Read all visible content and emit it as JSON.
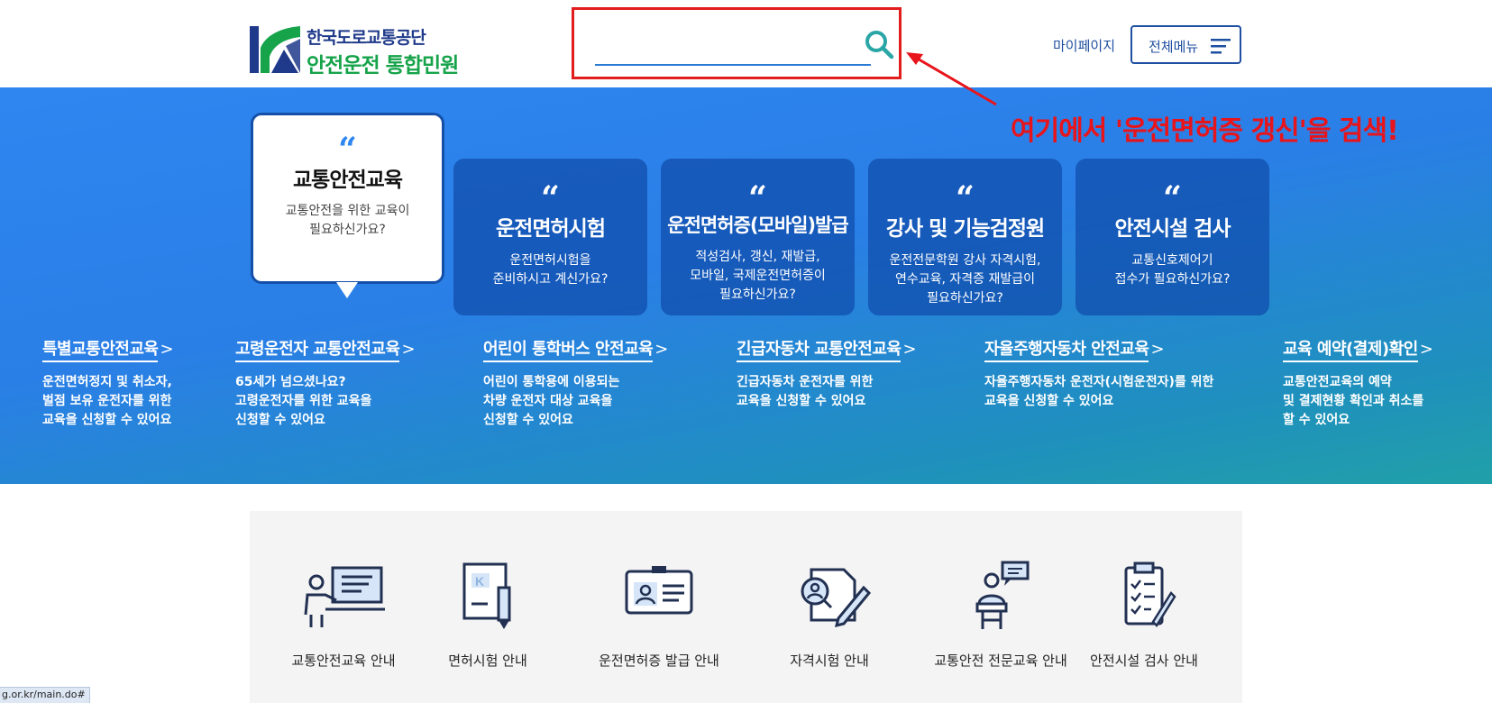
{
  "header": {
    "logo_org": "한국도로교통공단",
    "logo_title": "안전운전 통합민원",
    "search_value": "",
    "mypage_label": "마이페이지",
    "allmenu_label": "전체메뉴"
  },
  "annotation": {
    "text": "여기에서 '운전면허증 갱신'을 검색!",
    "color": "#e8141b"
  },
  "banner": {
    "featured": {
      "title": "교통안전교육",
      "desc_line1": "교통안전을 위한 교육이",
      "desc_line2": "필요하신가요?"
    },
    "cards": [
      {
        "title": "운전면허시험",
        "desc": [
          "운전면허시험을",
          "준비하시고 계신가요?"
        ]
      },
      {
        "title": "운전면허증(모바일)발급",
        "desc": [
          "적성검사, 갱신, 재발급,",
          "모바일, 국제운전면허증이",
          "필요하신가요?"
        ]
      },
      {
        "title": "강사 및 기능검정원",
        "desc": [
          "운전전문학원 강사 자격시험,",
          "연수교육, 자격증 재발급이",
          "필요하신가요?"
        ]
      },
      {
        "title": "안전시설 검사",
        "desc": [
          "교통신호제어기",
          "접수가 필요하신가요?"
        ]
      }
    ],
    "links": [
      {
        "title": "특별교통안전교육",
        "desc": [
          "운전면허정지 및 취소자,",
          "벌점 보유 운전자를 위한",
          "교육을 신청할 수 있어요"
        ]
      },
      {
        "title": "고령운전자 교통안전교육",
        "desc": [
          "65세가 넘으셨나요?",
          "고령운전자를 위한 교육을",
          "신청할 수 있어요"
        ]
      },
      {
        "title": "어린이 통학버스 안전교육",
        "desc": [
          "어린이 통학용에 이용되는",
          "차량 운전자 대상 교육을",
          "신청할 수 있어요"
        ]
      },
      {
        "title": "긴급자동차 교통안전교육",
        "desc": [
          "긴급자동차 운전자를 위한",
          "교육을 신청할 수 있어요"
        ]
      },
      {
        "title": "자율주행자동차 안전교육",
        "desc": [
          "자율주행자동차 운전자(시험운전자)를 위한",
          "교육을 신청할 수 있어요"
        ]
      },
      {
        "title": "교육 예약(결제)확인",
        "desc": [
          "교통안전교육의 예약",
          "및 결제현황 확인과 취소를",
          "할 수 있어요"
        ]
      }
    ],
    "link_arrow": ">"
  },
  "quick_menu": [
    {
      "label": "교통안전교육 안내",
      "icon": "lecture-icon"
    },
    {
      "label": "면허시험 안내",
      "icon": "license-test-icon"
    },
    {
      "label": "운전면허증 발급 안내",
      "icon": "id-card-icon"
    },
    {
      "label": "자격시험 안내",
      "icon": "qualification-exam-icon"
    },
    {
      "label": "교통안전 전문교육 안내",
      "icon": "speaker-podium-icon"
    },
    {
      "label": "안전시설 검사 안내",
      "icon": "checklist-icon"
    }
  ],
  "status_url": "g.or.kr/main.do#",
  "colors": {
    "brand_blue": "#1f4fa0",
    "brand_green": "#16a34a",
    "banner_blue": "#2f86f0",
    "highlight_red": "#e11d1d"
  }
}
